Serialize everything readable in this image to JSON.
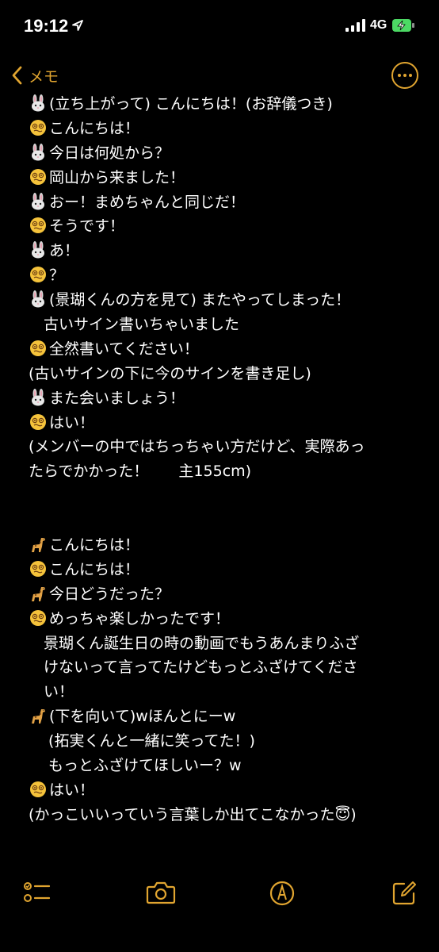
{
  "status_bar": {
    "time": "19:12",
    "network": "4G",
    "icons": [
      "location-arrow-icon",
      "signal-bars-icon",
      "battery-charging-icon"
    ]
  },
  "nav": {
    "back_label": "メモ",
    "back_icon": "chevron-left-icon",
    "more_icon": "ellipsis-circle-icon"
  },
  "accent_color": "#e1a530",
  "note_lines": [
    {
      "icon": "rabbit",
      "text": "(立ち上がって) こんにちは！(お辞儀つき)"
    },
    {
      "icon": "dizzy-face",
      "text": "こんにちは！"
    },
    {
      "icon": "rabbit",
      "text": "今日は何処から？"
    },
    {
      "icon": "dizzy-face",
      "text": "岡山から来ました！"
    },
    {
      "icon": "rabbit",
      "text": "おー！まめちゃんと同じだ！"
    },
    {
      "icon": "dizzy-face",
      "text": "そうです！"
    },
    {
      "icon": "rabbit",
      "text": "あ！"
    },
    {
      "icon": "dizzy-face",
      "text": "？"
    },
    {
      "icon": "rabbit",
      "text": "(景瑚くんの方を見て) またやってしまった！"
    },
    {
      "icon": "",
      "text": "　古いサイン書いちゃいました"
    },
    {
      "icon": "dizzy-face",
      "text": "全然書いてください！"
    },
    {
      "icon": "",
      "text": "(古いサインの下に今のサインを書き足し)"
    },
    {
      "icon": "rabbit",
      "text": "また会いましょう！"
    },
    {
      "icon": "dizzy-face",
      "text": "はい！"
    },
    {
      "icon": "",
      "text": "(メンバーの中ではちっちゃい方だけど、実際あっ"
    },
    {
      "icon": "",
      "text": "たらでかかった！　　主155cm)"
    },
    {
      "icon": "",
      "text": ""
    },
    {
      "icon": "",
      "text": ""
    },
    {
      "icon": "giraffe",
      "text": "こんにちは！"
    },
    {
      "icon": "dizzy-face",
      "text": "こんにちは！"
    },
    {
      "icon": "giraffe",
      "text": "今日どうだった？"
    },
    {
      "icon": "dizzy-face",
      "text": "めっちゃ楽しかったです！"
    },
    {
      "icon": "",
      "text": "　景瑚くん誕生日の時の動画でもうあんまりふざ"
    },
    {
      "icon": "",
      "text": "　けないって言ってたけどもっとふざけてくださ"
    },
    {
      "icon": "",
      "text": "　い！"
    },
    {
      "icon": "giraffe",
      "text": "(下を向いて)wほんとにーw"
    },
    {
      "icon": "",
      "text": "　 (拓実くんと一緒に笑ってた！)"
    },
    {
      "icon": "",
      "text": "　 もっとふざけてほしいー？w"
    },
    {
      "icon": "dizzy-face",
      "text": "はい！"
    },
    {
      "icon": "",
      "text": "(かっこいいっていう言葉しか出てこなかった😇)"
    }
  ],
  "toolbar": {
    "items": [
      "checklist-icon",
      "camera-icon",
      "markup-pen-icon",
      "compose-icon"
    ]
  }
}
